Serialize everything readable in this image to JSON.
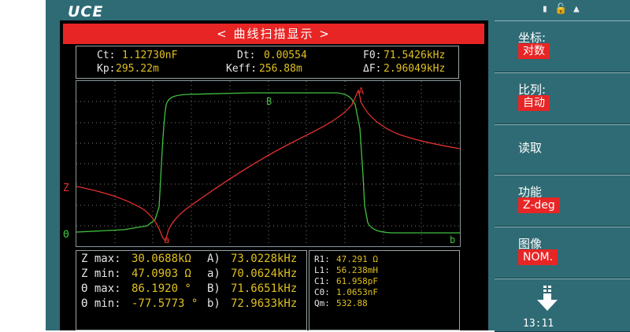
{
  "brand": "UCE",
  "status_icons": [
    "battery-icon",
    "lock-icon",
    "up-arrow-icon"
  ],
  "title": "< 曲线扫描显示 >",
  "params": {
    "ct_label": "Ct:",
    "ct_value": "1.12730nF",
    "dt_label": "Dt:",
    "dt_value": "0.00554",
    "f0_label": "F0:",
    "f0_value": "71.5426kHz",
    "kp_label": "Kp:",
    "kp_value": "295.22m",
    "keff_label": "Keff:",
    "keff_value": "256.88m",
    "df_label": "ΔF:",
    "df_value": "2.96049kHz"
  },
  "plot": {
    "z_axis_label": "Z",
    "theta_axis_label": "Θ",
    "markers": {
      "A": "A",
      "a": "a",
      "B": "B",
      "b": "b"
    },
    "colors": {
      "z": "#e03030",
      "theta": "#40c040",
      "grid": "#7a7a7a"
    }
  },
  "stats": [
    {
      "label": "Z max:",
      "value": "30.0688kΩ",
      "mlabel": "A)",
      "mvalue": "73.0228kHz"
    },
    {
      "label": "Z min:",
      "value": "47.0903 Ω",
      "mlabel": "a)",
      "mvalue": "70.0624kHz"
    },
    {
      "label": "Θ max:",
      "value": "86.1920 °",
      "mlabel": "B)",
      "mvalue": "71.6651kHz"
    },
    {
      "label": "Θ min:",
      "value": "-77.5773 °",
      "mlabel": "b)",
      "mvalue": "72.9633kHz"
    }
  ],
  "equiv": [
    {
      "label": "R1:",
      "value": "47.291 Ω"
    },
    {
      "label": "L1:",
      "value": "56.238mH"
    },
    {
      "label": "C1:",
      "value": "61.958pF"
    },
    {
      "label": "C0:",
      "value": "1.0653nF"
    },
    {
      "label": "Qm:",
      "value": "532.88"
    }
  ],
  "sidebar": [
    {
      "title": "坐标:",
      "value": "对数"
    },
    {
      "title": "比列:",
      "value": "自动"
    },
    {
      "title": "读取",
      "value": ""
    },
    {
      "title": "功能",
      "value": "Z-deg"
    },
    {
      "title": "图像",
      "value": "NOM."
    }
  ],
  "clock": "13:11"
}
